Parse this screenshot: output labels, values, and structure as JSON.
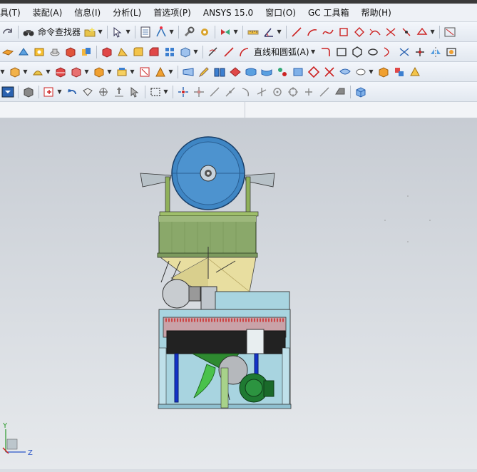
{
  "menu": {
    "items": [
      "具(T)",
      "装配(A)",
      "信息(I)",
      "分析(L)",
      "首选项(P)",
      "ANSYS 15.0",
      "窗口(O)",
      "GC 工具箱",
      "帮助(H)"
    ]
  },
  "toolbar1": {
    "command_finder_label": "命令查找器"
  },
  "toolbar2": {
    "line_arc_label": "直线和圆弧(A)"
  },
  "viewport": {
    "triad": {
      "y_label": "Y",
      "z_label": "Z"
    }
  },
  "colors": {
    "blower_blue": "#3f86c4",
    "hopper_green": "#8aa86a",
    "cone_yellow": "#e8dea0",
    "frame_lightblue": "#a8d4e0",
    "motor_green": "#1f7a32",
    "support_blue": "#1232c8"
  }
}
